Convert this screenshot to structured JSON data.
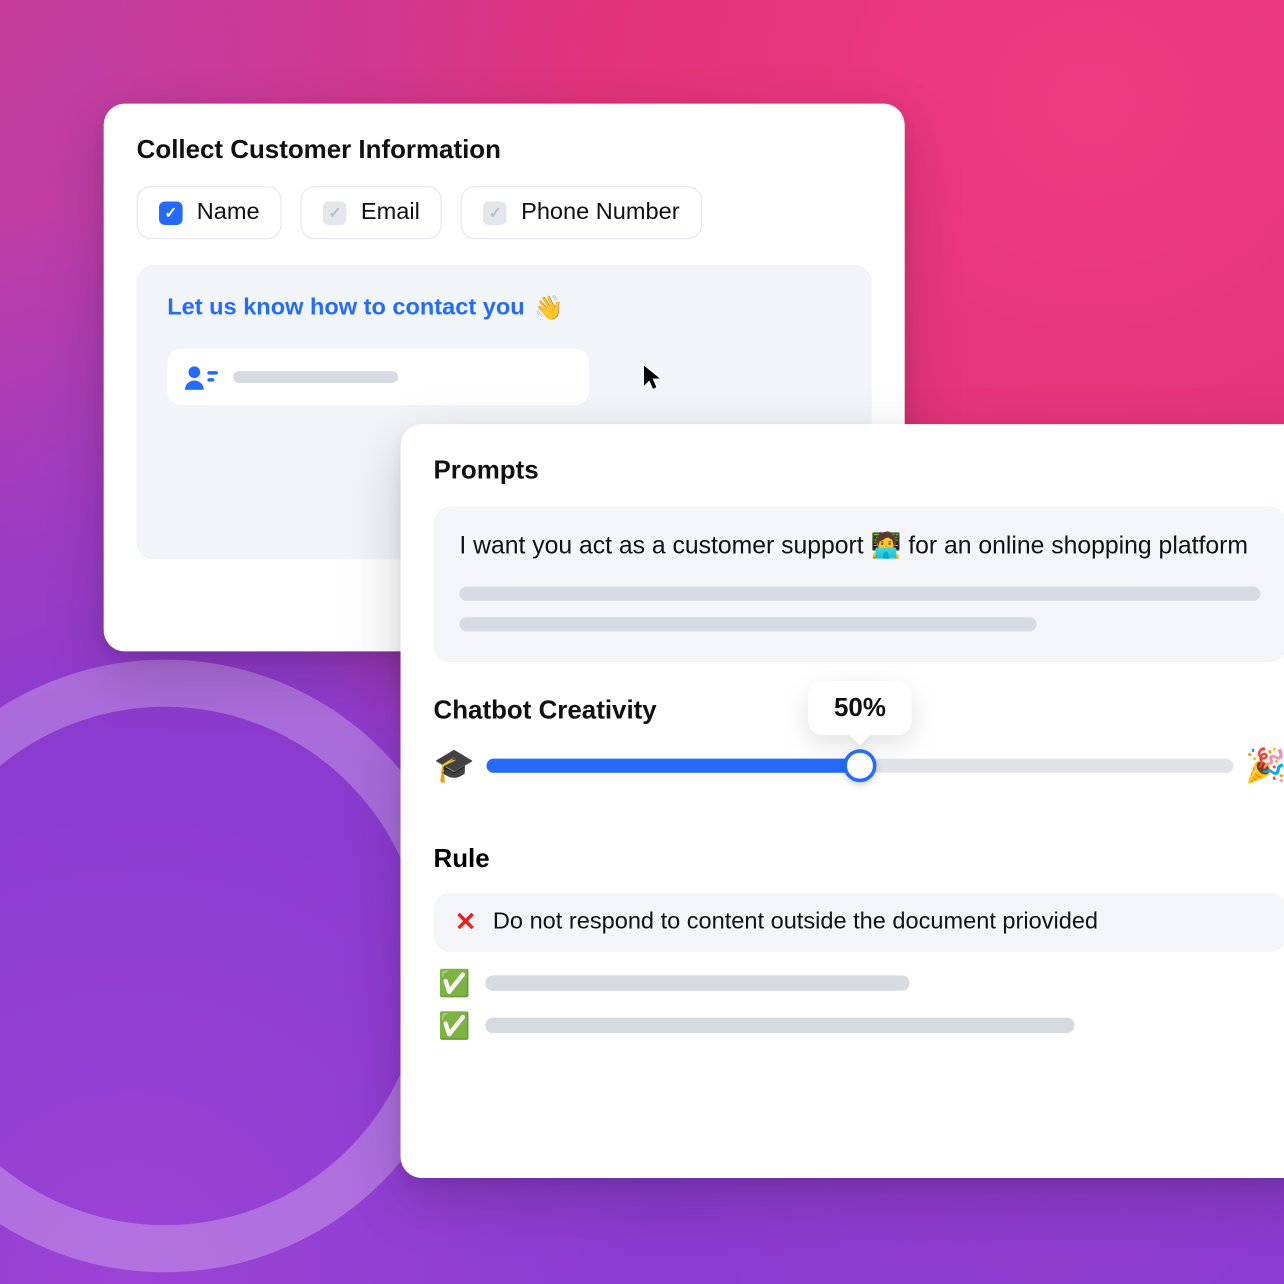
{
  "collect": {
    "title": "Collect Customer Information",
    "options": [
      {
        "label": "Name",
        "checked": true
      },
      {
        "label": "Email",
        "checked": false
      },
      {
        "label": "Phone Number",
        "checked": false
      }
    ],
    "preview_heading": "Let us know how to contact you",
    "preview_emoji": "👋"
  },
  "prompts": {
    "title": "Prompts",
    "text_prefix": "I want you act as a customer support ",
    "emoji": "🧑‍💻",
    "text_suffix": " for an online shopping platform"
  },
  "creativity": {
    "title": "Chatbot Creativity",
    "percent": 50,
    "tooltip": "50%",
    "left_emoji": "🎓",
    "right_emoji": "🎉"
  },
  "rule": {
    "title": "Rule",
    "items": [
      {
        "status": "deny",
        "text": "Do not respond to content outside the document priovided"
      },
      {
        "status": "allow",
        "text": ""
      },
      {
        "status": "allow",
        "text": ""
      }
    ]
  },
  "icons": {
    "check_glyph": "✓",
    "deny_glyph": "✕",
    "allow_glyph": "✅"
  }
}
